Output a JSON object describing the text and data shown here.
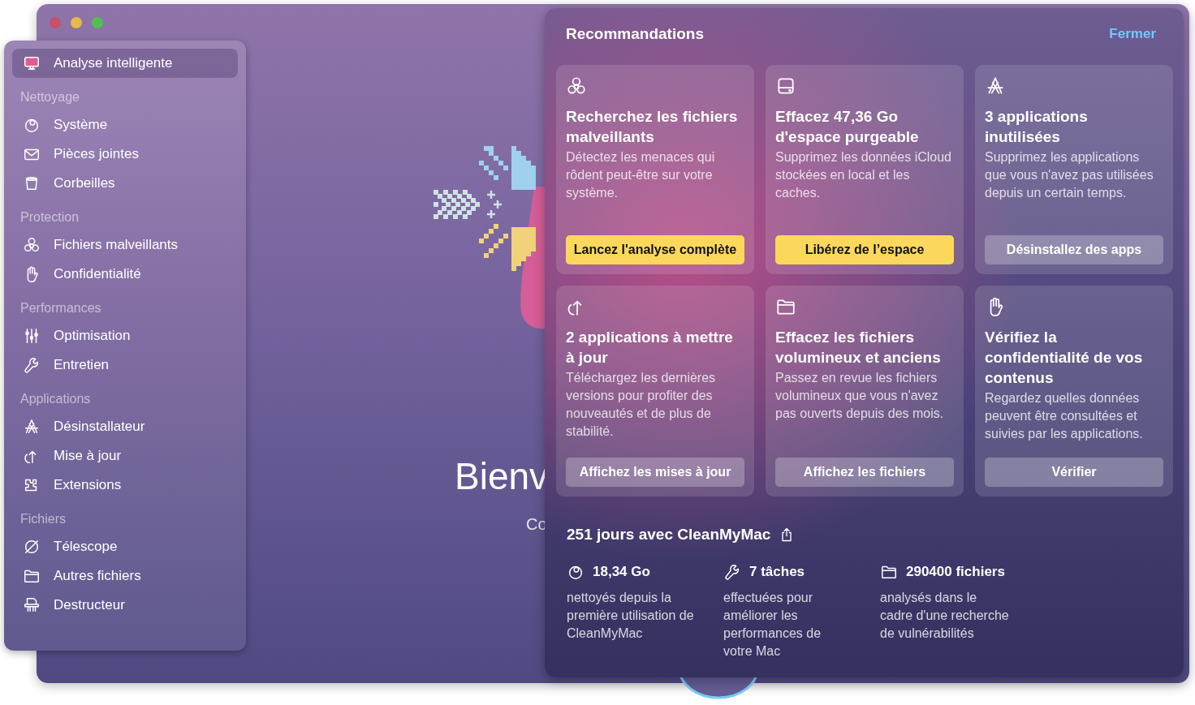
{
  "sidebar": {
    "items": [
      {
        "kind": "item",
        "label": "Analyse intelligente",
        "selected": true
      },
      {
        "kind": "heading",
        "label": "Nettoyage"
      },
      {
        "kind": "item",
        "label": "Système",
        "selected": false
      },
      {
        "kind": "item",
        "label": "Pièces jointes",
        "selected": false
      },
      {
        "kind": "item",
        "label": "Corbeilles",
        "selected": false
      },
      {
        "kind": "heading",
        "label": "Protection"
      },
      {
        "kind": "item",
        "label": "Fichiers malveillants",
        "selected": false
      },
      {
        "kind": "item",
        "label": "Confidentialité",
        "selected": false
      },
      {
        "kind": "heading",
        "label": "Performances"
      },
      {
        "kind": "item",
        "label": "Optimisation",
        "selected": false
      },
      {
        "kind": "item",
        "label": "Entretien",
        "selected": false
      },
      {
        "kind": "heading",
        "label": "Applications"
      },
      {
        "kind": "item",
        "label": "Désinstallateur",
        "selected": false
      },
      {
        "kind": "item",
        "label": "Mise à jour",
        "selected": false
      },
      {
        "kind": "item",
        "label": "Extensions",
        "selected": false
      },
      {
        "kind": "heading",
        "label": "Fichiers"
      },
      {
        "kind": "item",
        "label": "Télescope",
        "selected": false
      },
      {
        "kind": "item",
        "label": "Autres fichiers",
        "selected": false
      },
      {
        "kind": "item",
        "label": "Destructeur",
        "selected": false
      }
    ]
  },
  "welcome": {
    "title": "Bienv",
    "subtitle": "Co"
  },
  "recommendations": {
    "title": "Recommandations",
    "close": "Fermer",
    "cards": [
      {
        "title": "Recherchez les fichiers malveillants",
        "description": "Détectez les menaces qui rôdent peut-être sur votre système.",
        "button": "Lancez l'analyse complète",
        "highlighted": true
      },
      {
        "title": "Effacez 47,36 Go d'espace purgeable",
        "description": "Supprimez les données iCloud stockées en local et les caches.",
        "button": "Libérez de l’espace",
        "highlighted": true
      },
      {
        "title": "3 applications inutilisées",
        "description": "Supprimez les applications que vous n'avez pas utilisées depuis un certain temps.",
        "button": "Désinstallez des apps",
        "highlighted": false
      },
      {
        "title": "2 applications à mettre à jour",
        "description": "Téléchargez les dernières versions pour profiter des nouveautés et de plus de stabilité.",
        "button": "Affichez les mises à jour",
        "highlighted": false
      },
      {
        "title": "Effacez les fichiers volumineux et anciens",
        "description": "Passez en revue les fichiers volumineux que vous n'avez pas ouverts depuis des mois.",
        "button": "Affichez les fichiers",
        "highlighted": false
      },
      {
        "title": "Vérifiez la confidentialité de vos contenus",
        "description": "Regardez quelles données peuvent être consultées et suivies par les applications.",
        "button": "Vérifier",
        "highlighted": false
      }
    ]
  },
  "stats": {
    "title": "251 jours avec CleanMyMac",
    "items": [
      {
        "value": "18,34 Go",
        "description": "nettoyés depuis la première utilisation de CleanMyMac"
      },
      {
        "value": "7 tâches",
        "description": "effectuées pour améliorer les performances de votre Mac"
      },
      {
        "value": "290400 fichiers",
        "description": "analysés dans le cadre d'une recherche de vulnérabilités"
      }
    ]
  }
}
